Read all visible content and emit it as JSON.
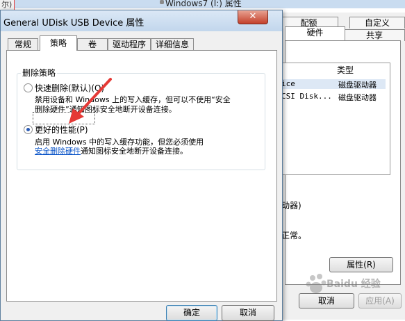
{
  "background_window": {
    "title": "Windows7 (I:) 属性",
    "left_mark": "尔)",
    "tabs_row1": [
      "配额",
      "自定义"
    ],
    "tabs_row2": [
      "硬件",
      "共享"
    ],
    "list_header": "类型",
    "rows": [
      {
        "name": "ice",
        "type": "磁盘驱动器"
      },
      {
        "name": "CSI Disk...",
        "type": "磁盘驱动器"
      }
    ],
    "device_prop_header": "动器)",
    "status_text": "正常。",
    "properties_button": "属性(R)",
    "cancel_button": "取消",
    "apply_button": "应用(A)"
  },
  "dialog": {
    "title": "General UDisk USB Device 属性",
    "close_glyph": "✕",
    "tabs": [
      "常规",
      "策略",
      "卷",
      "驱动程序",
      "详细信息"
    ],
    "active_tab": "策略",
    "group_title": "删除策略",
    "option1": {
      "label": "快速删除(默认)(Q)",
      "desc_line1": "禁用设备和 Windows 上的写入缓存，但可以不使用“安全",
      "desc_line2": "删除硬件”通知图标安全地断开设备连接。"
    },
    "option2": {
      "label": "更好的性能(P)",
      "desc_line1": "启用 Windows 中的写入缓存功能，但您必须使用",
      "desc_link": "安全删除硬件",
      "desc_line2_rest": "通知图标安全地断开设备连接。"
    },
    "selected_option": "option2",
    "ok_button": "确定",
    "cancel_button": "取消"
  },
  "watermark": "Baidu 经验",
  "colors": {
    "arrow": "#e53935",
    "titlebar": "#c2d6ec",
    "close_button": "#c4402b",
    "link": "#0a54c8",
    "radio_dot": "#2a5bb5"
  }
}
